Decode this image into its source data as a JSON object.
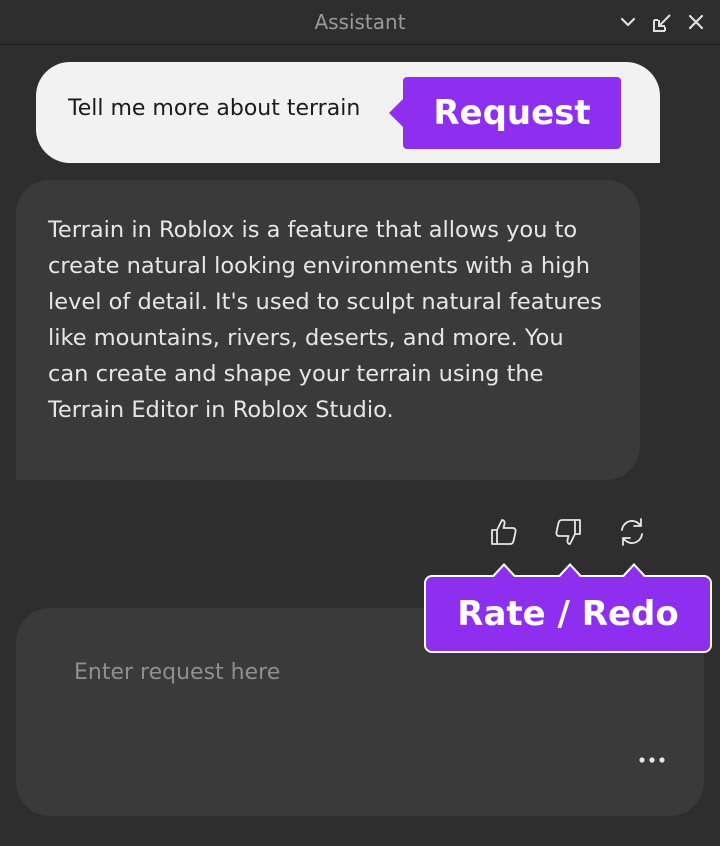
{
  "window": {
    "title": "Assistant"
  },
  "titlebar_icons": [
    "chevron-down-icon",
    "undock-icon",
    "close-icon"
  ],
  "conversation": {
    "user_message": "Tell me more about terrain",
    "assistant_reply": "Terrain in Roblox is a feature that allows you to create natural looking environments with a high level of detail. It's used to sculpt natural features like mountains, rivers, deserts, and more. You can create and shape your terrain using the Terrain Editor in Roblox Studio."
  },
  "actions": [
    "thumbs-up-icon",
    "thumbs-down-icon",
    "redo-icon"
  ],
  "callouts": {
    "request": "Request",
    "rate_redo": "Rate / Redo"
  },
  "input": {
    "placeholder": "Enter request here",
    "value": ""
  },
  "colors": {
    "background": "#2e2e2e",
    "bubble_dark": "#3a3a3a",
    "bubble_light": "#f2f2f2",
    "callout_purple": "#8e2ff0",
    "text_light": "#e6e6e6"
  }
}
